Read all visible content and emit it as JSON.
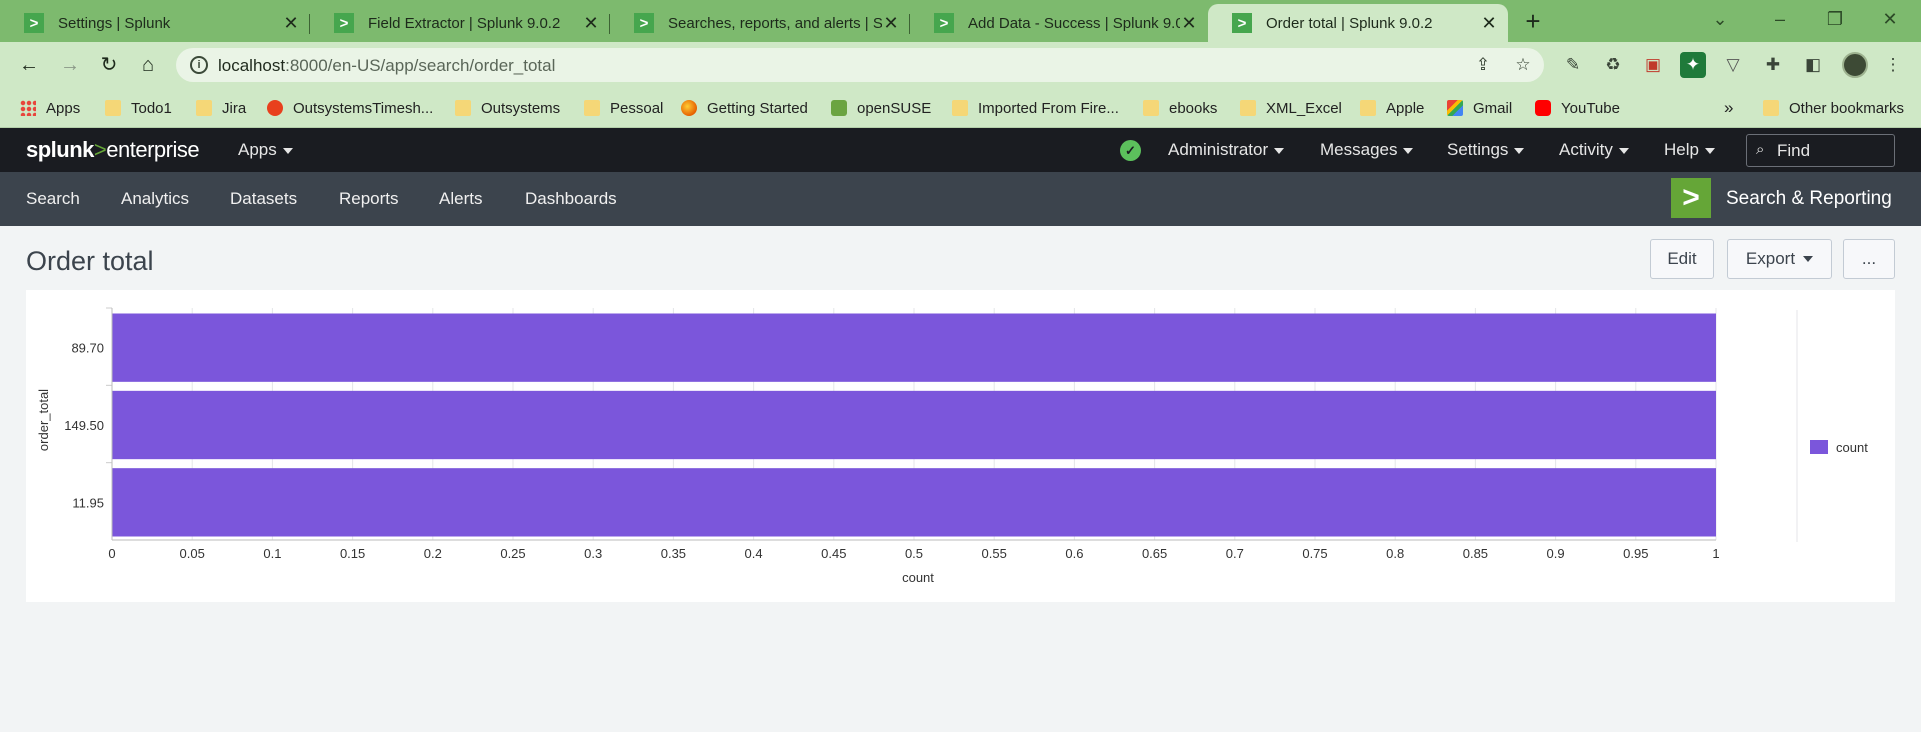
{
  "browser": {
    "tabs": [
      {
        "title": "Settings | Splunk",
        "active": false
      },
      {
        "title": "Field Extractor | Splunk 9.0.2",
        "active": false
      },
      {
        "title": "Searches, reports, and alerts | Spl",
        "active": false
      },
      {
        "title": "Add Data - Success | Splunk 9.0.2",
        "active": false
      },
      {
        "title": "Order total | Splunk 9.0.2",
        "active": true
      }
    ],
    "url_host": "localhost",
    "url_path": ":8000/en-US/app/search/order_total",
    "bookmarks": [
      {
        "label": "Apps",
        "icon": "apps-grid-icon"
      },
      {
        "label": "Todo1",
        "icon": "folder-icon"
      },
      {
        "label": "Jira",
        "icon": "folder-icon"
      },
      {
        "label": "OutsystemsTimesh...",
        "icon": "outsystems-icon"
      },
      {
        "label": "Outsystems",
        "icon": "folder-icon"
      },
      {
        "label": "Pessoal",
        "icon": "folder-icon"
      },
      {
        "label": "Getting Started",
        "icon": "firefox-icon"
      },
      {
        "label": "openSUSE",
        "icon": "opensuse-icon"
      },
      {
        "label": "Imported From Fire...",
        "icon": "folder-icon"
      },
      {
        "label": "ebooks",
        "icon": "folder-icon"
      },
      {
        "label": "XML_Excel",
        "icon": "folder-icon"
      },
      {
        "label": "Apple",
        "icon": "folder-icon"
      },
      {
        "label": "Gmail",
        "icon": "gmail-icon"
      },
      {
        "label": "YouTube",
        "icon": "youtube-icon"
      }
    ],
    "bookmarks_overflow": "»",
    "other_bookmarks": "Other bookmarks"
  },
  "splunk": {
    "logo_prefix": "splunk",
    "logo_gt": ">",
    "logo_suffix": "enterprise",
    "apps_menu": "Apps",
    "menus": {
      "administrator": "Administrator",
      "messages": "Messages",
      "settings": "Settings",
      "activity": "Activity",
      "help": "Help"
    },
    "find_placeholder": "Find",
    "app_nav": [
      "Search",
      "Analytics",
      "Datasets",
      "Reports",
      "Alerts",
      "Dashboards"
    ],
    "app_name": "Search & Reporting"
  },
  "page": {
    "title": "Order total",
    "edit_label": "Edit",
    "export_label": "Export",
    "more_label": "..."
  },
  "colors": {
    "bar": "#7b56db",
    "splunk_green": "#65a637"
  },
  "chart_data": {
    "type": "bar",
    "orientation": "horizontal",
    "categories": [
      "89.70",
      "149.50",
      "11.95"
    ],
    "series": [
      {
        "name": "count",
        "values": [
          1,
          1,
          1
        ]
      }
    ],
    "xlabel": "count",
    "ylabel": "order_total",
    "xlim": [
      0,
      1
    ],
    "xticks": [
      "0",
      "0.05",
      "0.1",
      "0.15",
      "0.2",
      "0.25",
      "0.3",
      "0.35",
      "0.4",
      "0.45",
      "0.5",
      "0.55",
      "0.6",
      "0.65",
      "0.7",
      "0.75",
      "0.8",
      "0.85",
      "0.9",
      "0.95",
      "1"
    ],
    "grid": true,
    "legend": "right"
  }
}
